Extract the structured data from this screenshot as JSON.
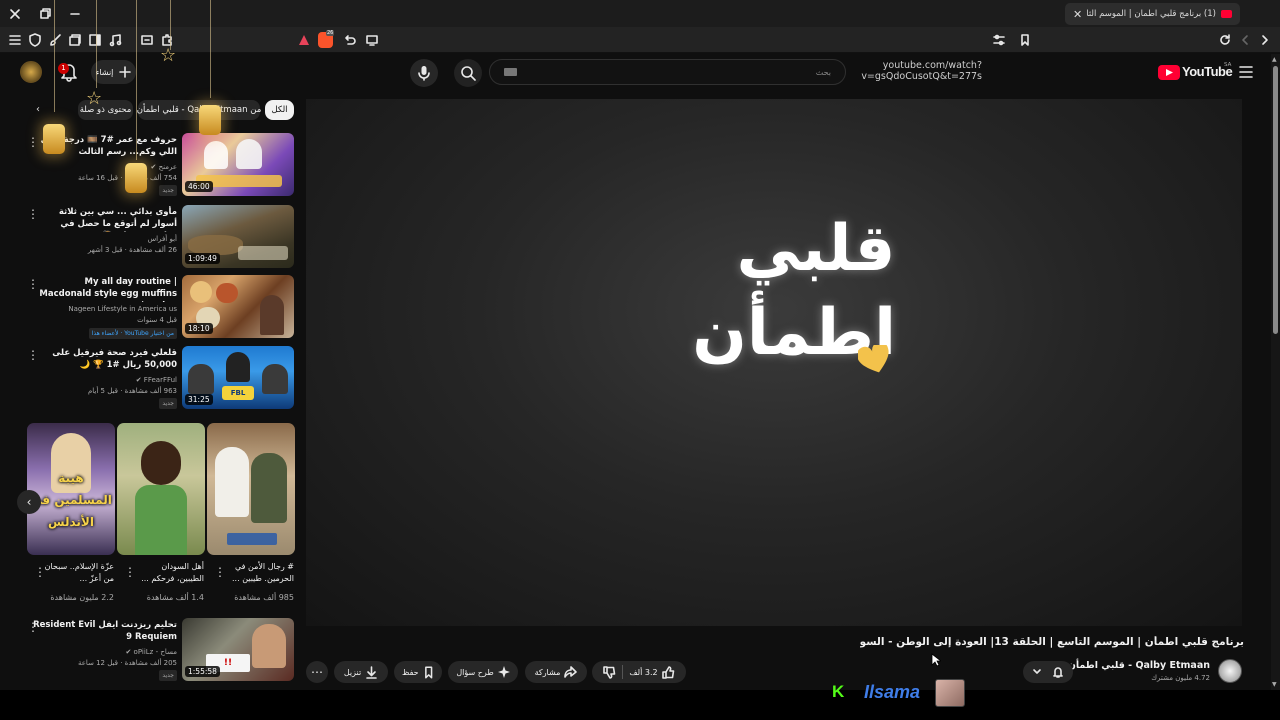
{
  "browser": {
    "tab_title": "(1) برنامج قلبي اطمأن | الموسم الثا",
    "url": "youtube.com/watch?v=gsQdoCusotQ&t=277s"
  },
  "header": {
    "logo_text": "YouTube",
    "region": "SA",
    "search_placeholder": "بحث",
    "create_label": "إنشاء",
    "notif_count": "1"
  },
  "chips": [
    {
      "label": "الكل",
      "active": true
    },
    {
      "label": "من Qalby Etmaan - قلبي اطمأن",
      "active": false
    },
    {
      "label": "محتوى ذو صلة",
      "active": false
    }
  ],
  "related": [
    {
      "title": "حروف مع عمر #7 🎞️ درجة والي اللي وكم... رسم الثالث",
      "channel": "عرمنح ✔",
      "views": "754 ألف مشاهدة · قبل 16 ساعة",
      "badge": "جديد",
      "duration": "46:00"
    },
    {
      "title": "مأوى بدائي ... سي بين ثلاثة أسوار لم أتوقع ما حصل في مطبس سدوان 🥘",
      "channel": "أبو أفراس",
      "views": "26 ألف مشاهدة · قبل 3 أشهر",
      "badge": "",
      "duration": "1:09:49"
    },
    {
      "title": "My all day routine | Macdonald style egg muffins recipe | ...",
      "channel": "Nageen Lifestyle in America us",
      "views": "قبل 4 سنوات",
      "badge": "من اختيار YouTube · لأعضاء هذا",
      "duration": "18:10"
    },
    {
      "title": "قلعلي فيرد صحة فيرفيل على 50,000 ريال #1 🏆 🌙",
      "channel": "FFearFFul ✔",
      "views": "963 ألف مشاهدة · قبل 5 أيام",
      "badge": "جديد",
      "duration": "31:25"
    },
    {
      "title": "تحليم ريزدنت ايفل Resident Evil 9 Requiem",
      "channel": "مساح - oPiiLz ✔",
      "views": "205 ألف مشاهدة · قبل 12 ساعة",
      "badge": "جديد",
      "duration": "1:55:58"
    }
  ],
  "shorts": [
    {
      "title": "عزّة الإسلام.. سبحان من أعزّ ...",
      "views": "2.2 مليون مشاهدة",
      "caption": "هيبة المسلمين في الأندلس"
    },
    {
      "title": "أهل السودان الطيبين، فرحكم ...",
      "views": "1.4 ألف مشاهدة",
      "caption": ""
    },
    {
      "title": "# رجال الأمن في الحرمين. طيبين ...",
      "views": "985 ألف مشاهدة",
      "caption": ""
    }
  ],
  "video": {
    "title": "برنامج قلبي اطمأن | الموسم التاسع | الحلقة 13| العودة إلى الوطن - السودان",
    "channel": "Qalby Etmaan - قلبي اطمأن",
    "subscribers": "4.72 مليون مشترك",
    "likes": "3.2 ألف",
    "share": "مشاركة",
    "ask": "طرح سؤال",
    "save": "حفظ",
    "download": "تنزيل",
    "logo_line1": "قلبي",
    "logo_line2": "اطمأن"
  },
  "overlay_brand": "Ilsama",
  "colors": {
    "accent": "#ff0033",
    "bg": "#0f0f0f",
    "gold": "#f3c24b"
  }
}
